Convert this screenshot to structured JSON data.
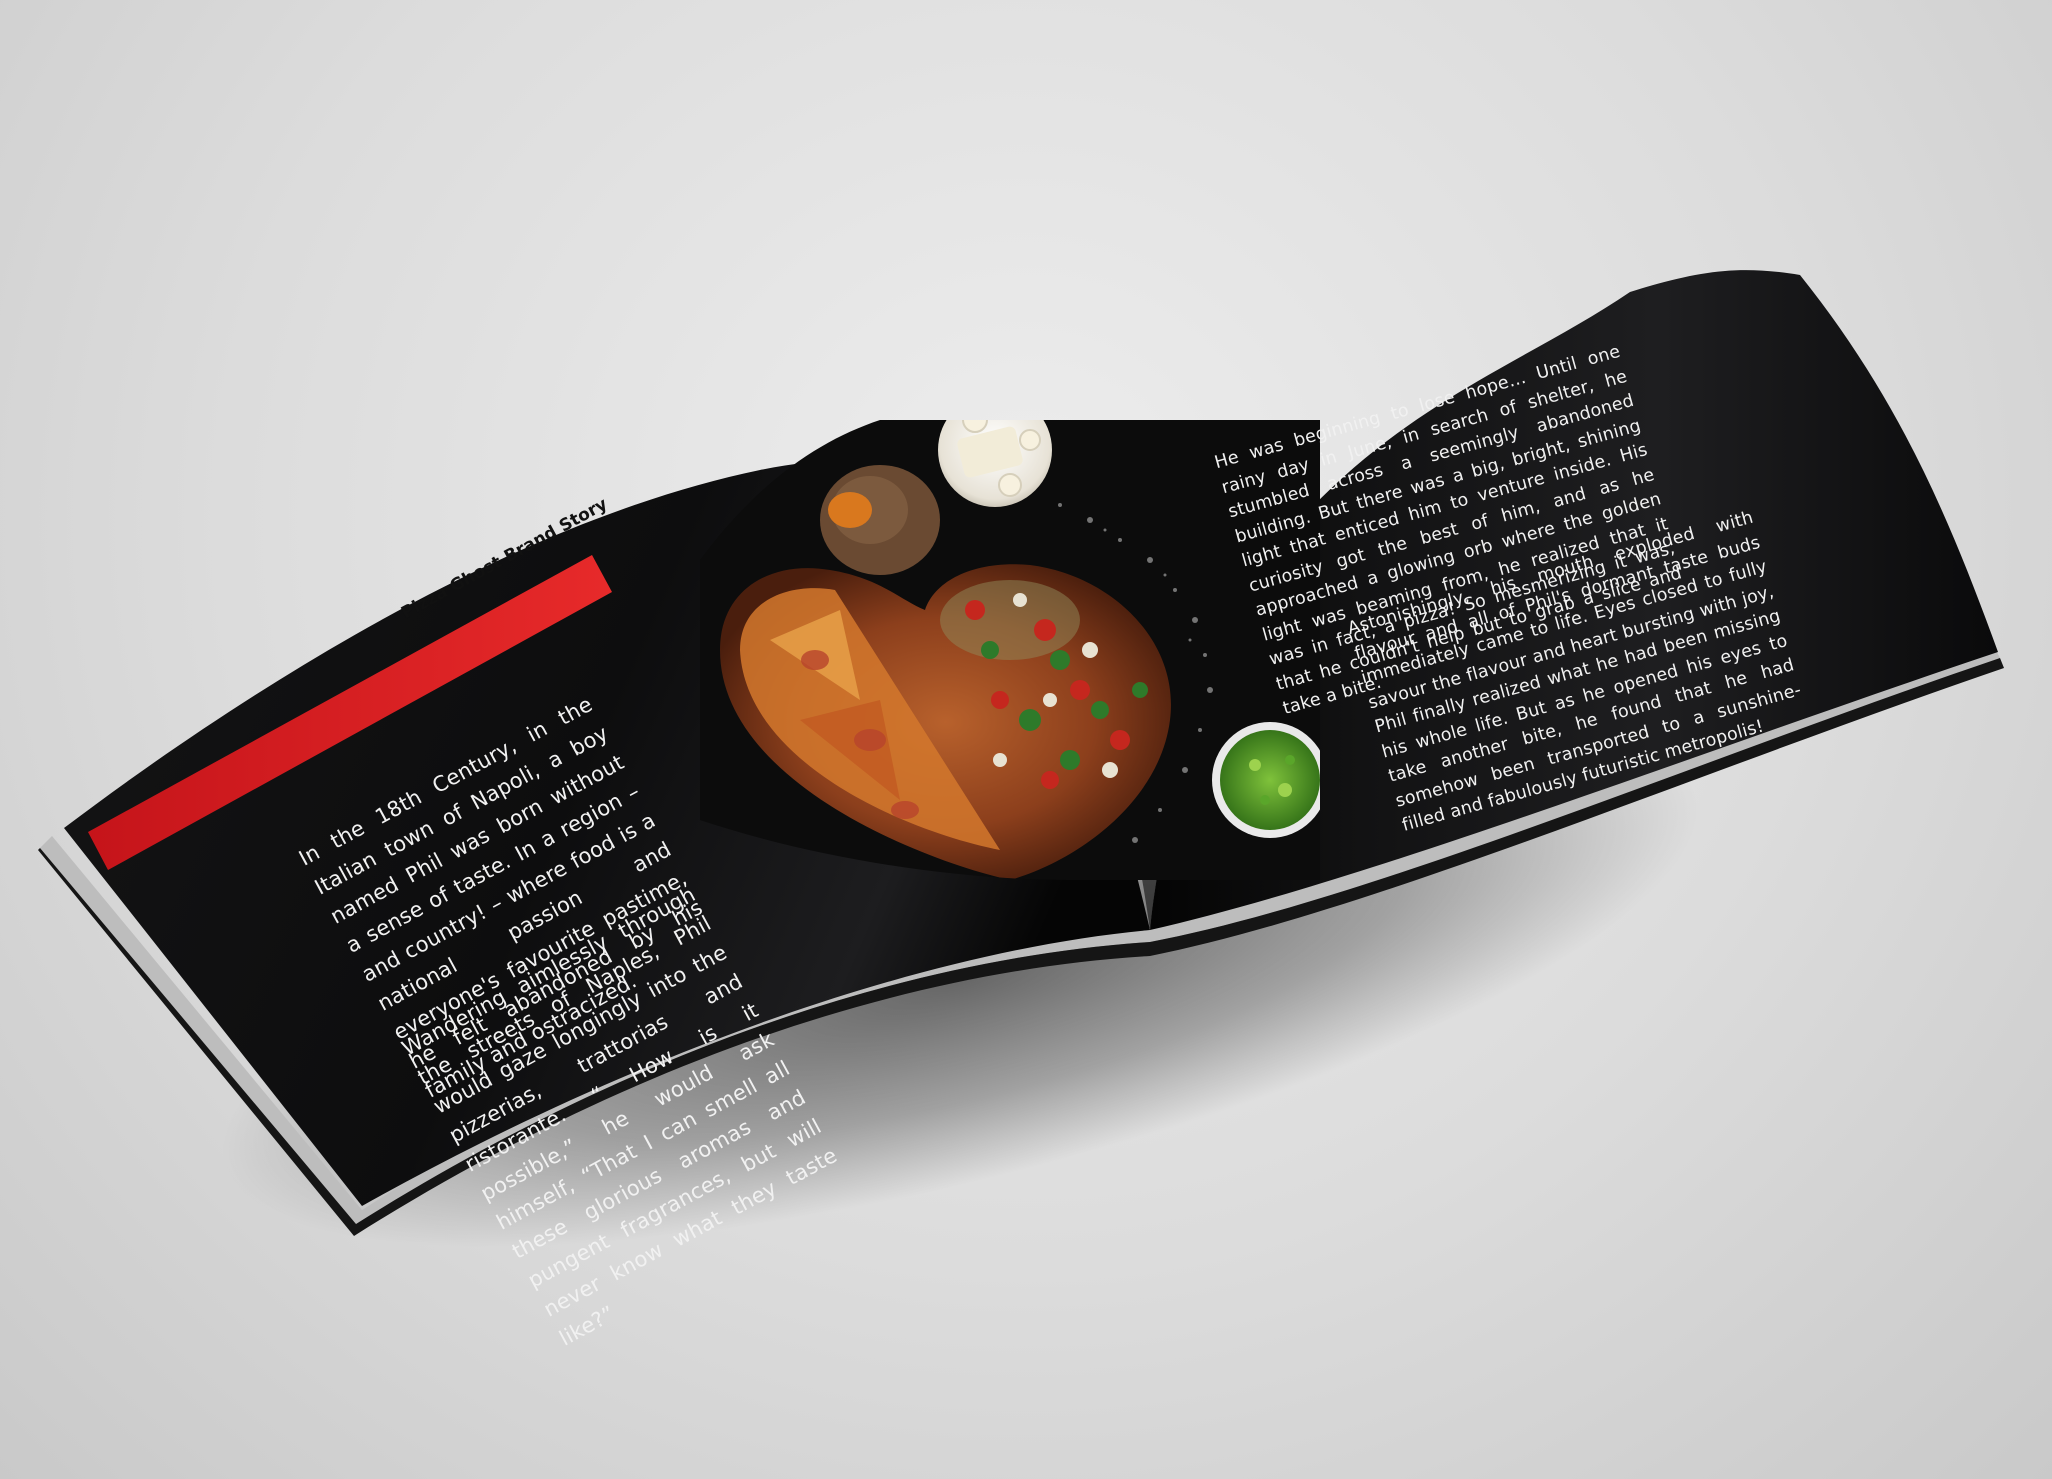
{
  "brochure": {
    "section_title": "Pizza Ghost Brand Story",
    "left_paragraphs": [
      "In the 18th Century, in the Italian town of Napoli, a boy named Phil was born without a sense of taste. In a region – and country! – where food is a national passion and everyone's favourite pastime, he felt abandoned by his family and ostracized.",
      "Wandering aimlessly through the streets of Naples, Phil would gaze longingly into the pizzerias, trattorias and ristorante. “ How is it possible,” he would ask himself, “That I can smell all these glorious aromas and pungent fragrances, but will never know what they taste like?”"
    ],
    "right_paragraphs": [
      "He was beginning to lose hope… Until one rainy day in June, in search of shelter, he stumbled across a seemingly abandoned building. But there was a big, bright, shining light that enticed him to venture inside. His curiosity got the best of him, and as he approached a glowing orb where the golden light was beaming from, he realized that it was in fact, a pizza! So mesmerizing it was, that he couldn't help but to grab a slice and take a bite.",
      "Astonishingly, his mouth exploded with flavour and all of Phil's dormant taste buds immediately came to life. Eyes closed to fully savour the flavour and heart bursting with joy, Phil finally realized what he had been missing his whole life. But as he opened his eyes to take another bite, he found that he had somehow been transported to a sunshine-filled and fabulously futuristic metropolis!"
    ],
    "colors": {
      "page": "#0e0e0f",
      "accent": "#d8191c",
      "text": "#f1f1f1",
      "background": "#dcdcdc"
    },
    "photo_subjects": [
      "heart-shaped-pizza",
      "cheese-bowl",
      "chopped-herbs-bowl",
      "cutting-board",
      "flour-dust"
    ]
  }
}
